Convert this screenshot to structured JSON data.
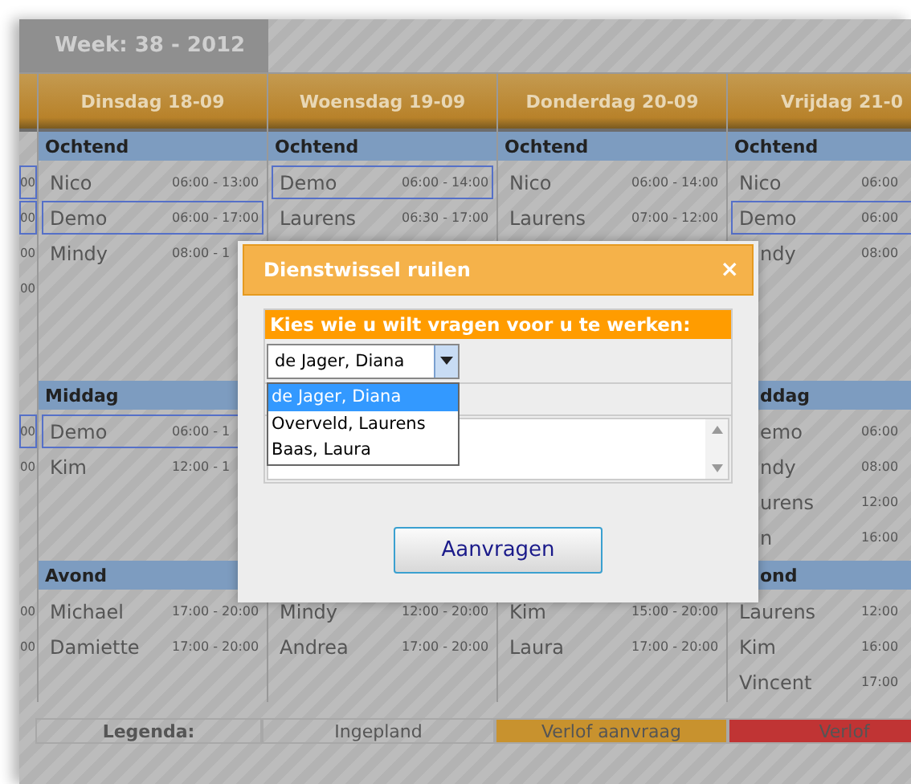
{
  "week_tab": "Week: 38 - 2012",
  "columns": [
    {
      "sections": [
        {
          "kind": "morning",
          "entries": [
            {
              "time": "00",
              "highlighted": true
            },
            {
              "time": "00",
              "highlighted": true
            },
            {
              "time": "00",
              "highlighted": false
            },
            {
              "time": "00",
              "highlighted": false
            }
          ]
        },
        {
          "kind": "afternoon",
          "entries": [
            {
              "time": "00",
              "highlighted": true
            },
            {
              "time": "00",
              "highlighted": false
            }
          ]
        },
        {
          "kind": "evening",
          "entries": [
            {
              "time": "00",
              "highlighted": false
            },
            {
              "time": "00",
              "highlighted": false
            }
          ]
        }
      ]
    },
    {
      "header": "Dinsdag 18-09",
      "sections": [
        {
          "kind": "morning",
          "label": "Ochtend",
          "entries": [
            {
              "name": "Nico",
              "time": "06:00 - 13:00",
              "highlighted": false
            },
            {
              "name": "Demo",
              "time": "06:00 - 17:00",
              "highlighted": true
            },
            {
              "name": "Mindy",
              "time": "08:00 - 1",
              "highlighted": false
            }
          ]
        },
        {
          "kind": "afternoon",
          "label": "Middag",
          "entries": [
            {
              "name": "Demo",
              "time": "06:00 - 1",
              "highlighted": true
            },
            {
              "name": "Kim",
              "time": "12:00 - 1",
              "highlighted": false
            }
          ]
        },
        {
          "kind": "evening",
          "label": "Avond",
          "entries": [
            {
              "name": "Michael",
              "time": "17:00 - 20:00",
              "highlighted": false
            },
            {
              "name": "Damiette",
              "time": "17:00 - 20:00",
              "highlighted": false
            }
          ]
        }
      ]
    },
    {
      "header": "Woensdag 19-09",
      "sections": [
        {
          "kind": "morning",
          "label": "Ochtend",
          "entries": [
            {
              "name": "Demo",
              "time": "06:00 - 14:00",
              "highlighted": true
            },
            {
              "name": "Laurens",
              "time": "06:30 - 17:00",
              "highlighted": false
            }
          ]
        },
        {
          "kind": "afternoon"
        },
        {
          "kind": "evening",
          "entries": [
            {
              "name": "Mindy",
              "time": "12:00 - 20:00",
              "highlighted": false
            },
            {
              "name": "Andrea",
              "time": "17:00 - 20:00",
              "highlighted": false
            }
          ]
        }
      ]
    },
    {
      "header": "Donderdag 20-09",
      "sections": [
        {
          "kind": "morning",
          "label": "Ochtend",
          "entries": [
            {
              "name": "Nico",
              "time": "06:00 - 14:00",
              "highlighted": false
            },
            {
              "name": "Laurens",
              "time": "07:00 - 12:00",
              "highlighted": false
            }
          ]
        },
        {
          "kind": "afternoon"
        },
        {
          "kind": "evening",
          "entries": [
            {
              "name": "Kim",
              "time": "15:00 - 20:00",
              "highlighted": false
            },
            {
              "name": "Laura",
              "time": "17:00 - 20:00",
              "highlighted": false
            }
          ]
        }
      ]
    },
    {
      "header": "Vrijdag 21-0",
      "sections": [
        {
          "kind": "morning",
          "label": "Ochtend",
          "covered": false,
          "entries": [
            {
              "name": "Nico",
              "time": "06:00",
              "highlighted": false,
              "covered": false
            },
            {
              "name": "Demo",
              "time": "06:00",
              "highlighted": true,
              "covered": false
            },
            {
              "name": "ndy",
              "time": "08:00",
              "highlighted": false,
              "covered": true
            }
          ]
        },
        {
          "kind": "afternoon",
          "label": "ddag",
          "covered": true,
          "entries": [
            {
              "name": "emo",
              "time": "06:00",
              "highlighted": false,
              "covered": true
            },
            {
              "name": "ndy",
              "time": "08:00",
              "highlighted": false,
              "covered": true
            },
            {
              "name": "urens",
              "time": "12:00",
              "highlighted": false,
              "covered": true
            },
            {
              "name": "n",
              "time": "16:00",
              "highlighted": false,
              "covered": true
            }
          ]
        },
        {
          "kind": "evening",
          "label": "ond",
          "covered": true,
          "entries": [
            {
              "name": "Laurens",
              "time": "12:00",
              "highlighted": false,
              "covered": false
            },
            {
              "name": "Kim",
              "time": "16:00",
              "highlighted": false,
              "covered": false
            },
            {
              "name": "Vincent",
              "time": "17:00",
              "highlighted": false,
              "covered": false
            }
          ]
        }
      ]
    }
  ],
  "legend": [
    {
      "label": "Legenda:",
      "kind": "title"
    },
    {
      "label": "Ingepland",
      "kind": "plain"
    },
    {
      "label": "Verlof aanvraag",
      "kind": "color",
      "color": "#c8922e"
    },
    {
      "label": "Verlof",
      "kind": "color",
      "color": "#c03434"
    }
  ],
  "dialog": {
    "title": "Dienstwissel ruilen",
    "close": "×",
    "prompt": "Kies wie u wilt vragen voor u te werken:",
    "select": {
      "value": "de Jager, Diana",
      "expanded": true,
      "options": [
        {
          "label": "de Jager, Diana",
          "selected": true
        },
        {
          "label": "Overveld, Laurens",
          "selected": false
        },
        {
          "label": "Baas, Laura",
          "selected": false
        }
      ]
    },
    "button": "Aanvragen"
  }
}
